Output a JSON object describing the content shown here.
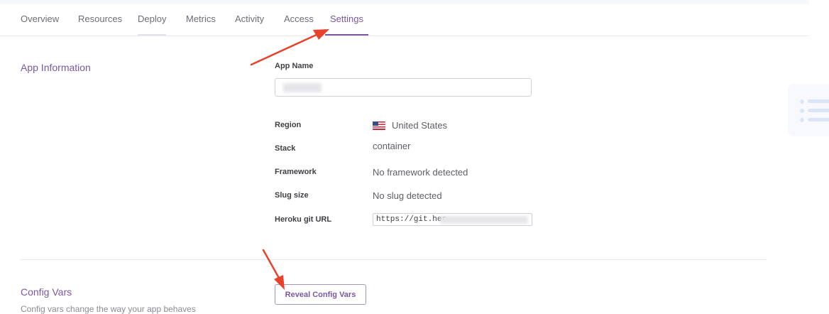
{
  "tabs": [
    {
      "label": "Overview"
    },
    {
      "label": "Resources"
    },
    {
      "label": "Deploy"
    },
    {
      "label": "Metrics"
    },
    {
      "label": "Activity"
    },
    {
      "label": "Access"
    },
    {
      "label": "Settings",
      "active": true
    }
  ],
  "app_information": {
    "title": "App Information",
    "app_name_label": "App Name",
    "region_label": "Region",
    "region_value": "United States",
    "stack_label": "Stack",
    "stack_value": "container",
    "framework_label": "Framework",
    "framework_value": "No framework detected",
    "slug_label": "Slug size",
    "slug_value": "No slug detected",
    "git_label": "Heroku git URL",
    "git_value": "https://git.her"
  },
  "config_vars": {
    "title": "Config Vars",
    "reveal_button": "Reveal Config Vars",
    "description": "Config vars change the way your app behaves"
  },
  "colors": {
    "accent": "#79589f",
    "annotation_arrow": "#e8412c"
  },
  "icons": {
    "region_flag": "us-flag-icon"
  }
}
